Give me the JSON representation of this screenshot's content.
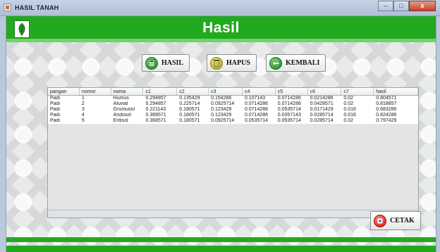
{
  "window": {
    "title": "HASIL TANAH",
    "min_label": "–",
    "max_label": "□",
    "close_label": "x"
  },
  "header": {
    "title": "Hasil",
    "logo_icon": "leaf-icon"
  },
  "toolbar": {
    "hasil_label": "HASIL",
    "hapus_label": "HAPUS",
    "kembali_label": "KEMBALI",
    "cetak_label": "CETAK"
  },
  "table": {
    "columns": [
      "pangan",
      "nomor",
      "nama",
      "c1",
      "c2",
      "c3",
      "c4",
      "c5",
      "c6",
      "c7",
      "hasil"
    ],
    "rows": [
      [
        "Padi",
        "1",
        "Humus",
        "0.294857",
        "0.135429",
        "0.154286",
        "0.107143",
        "0.0714286",
        "0.0214286",
        "0.02",
        "0.804571"
      ],
      [
        "Padi",
        "2",
        "Aluvial",
        "0.294857",
        "0.225714",
        "0.0925714",
        "0.0714286",
        "0.0714286",
        "0.0428571",
        "0.02",
        "0.818857"
      ],
      [
        "Padi",
        "3",
        "Grumusol",
        "0.221143",
        "0.180571",
        "0.123429",
        "0.0714286",
        "0.0535714",
        "0.0171429",
        "0.016",
        "0.683286"
      ],
      [
        "Padi",
        "4",
        "Andosol",
        "0.368571",
        "0.180571",
        "0.123429",
        "0.0714286",
        "0.0357143",
        "0.0285714",
        "0.016",
        "0.824286"
      ],
      [
        "Padi",
        "5",
        "Entisol",
        "0.368571",
        "0.180571",
        "0.0925714",
        "0.0535714",
        "0.0535714",
        "0.0285714",
        "0.02",
        "0.797429"
      ]
    ]
  },
  "colors": {
    "accent": "#23a91f",
    "accent_light": "#6fd26a",
    "background": "#e9eaea"
  }
}
